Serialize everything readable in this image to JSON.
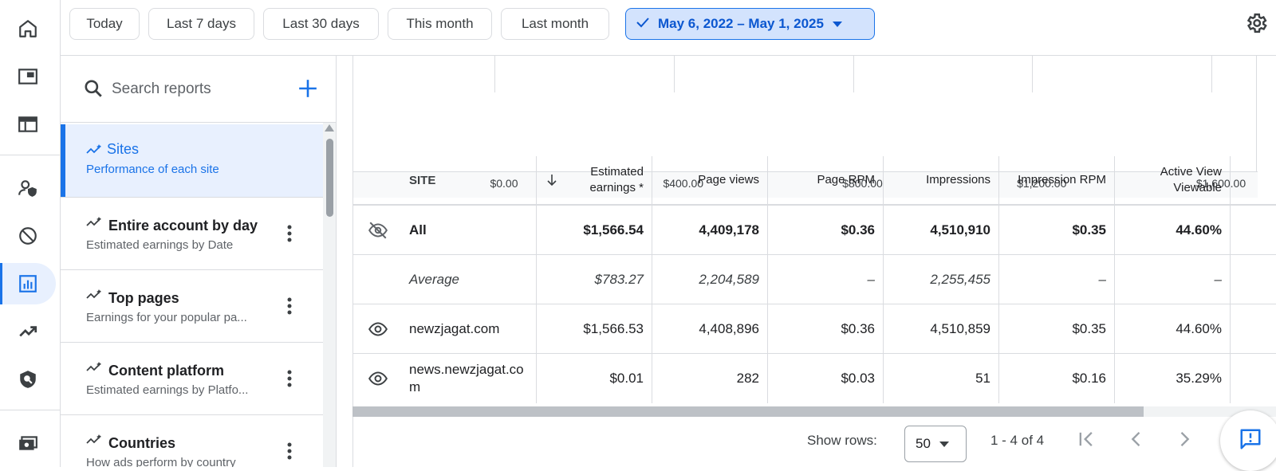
{
  "date_chips": [
    "Today",
    "Last 7 days",
    "Last 30 days",
    "This month",
    "Last month"
  ],
  "date_range": "May 6, 2022 – May 1, 2025",
  "search": {
    "placeholder": "Search reports"
  },
  "reports": [
    {
      "title": "Sites",
      "subtitle": "Performance of each site"
    },
    {
      "title": "Entire account by day",
      "subtitle": "Estimated earnings by Date"
    },
    {
      "title": "Top pages",
      "subtitle": "Earnings for your popular pa..."
    },
    {
      "title": "Content platform",
      "subtitle": "Estimated earnings by Platfo..."
    },
    {
      "title": "Countries",
      "subtitle": "How ads perform by country"
    }
  ],
  "chart_data": {
    "type": "bar",
    "x_ticks": [
      "$0.00",
      "$400.00",
      "$800.00",
      "$1,200.00",
      "$1,600.00"
    ],
    "xlim": [
      0,
      1600
    ]
  },
  "table": {
    "headers": [
      "SITE",
      "Estimated earnings *",
      "Page views",
      "Page RPM",
      "Impressions",
      "Impression RPM",
      "Active View Viewable"
    ],
    "rows": [
      {
        "site": "All",
        "values": [
          "$1,566.54",
          "4,409,178",
          "$0.36",
          "4,510,910",
          "$0.35",
          "44.60%"
        ]
      },
      {
        "site": "Average",
        "values": [
          "$783.27",
          "2,204,589",
          "–",
          "2,255,455",
          "–",
          "–"
        ]
      },
      {
        "site": "newzjagat.com",
        "values": [
          "$1,566.53",
          "4,408,896",
          "$0.36",
          "4,510,859",
          "$0.35",
          "44.60%"
        ]
      },
      {
        "site": "news.newzjagat.com",
        "values": [
          "$0.01",
          "282",
          "$0.03",
          "51",
          "$0.16",
          "35.29%"
        ]
      }
    ]
  },
  "footer": {
    "show_rows_label": "Show rows:",
    "rows_per_page": "50",
    "page_info": "1 - 4 of 4"
  }
}
